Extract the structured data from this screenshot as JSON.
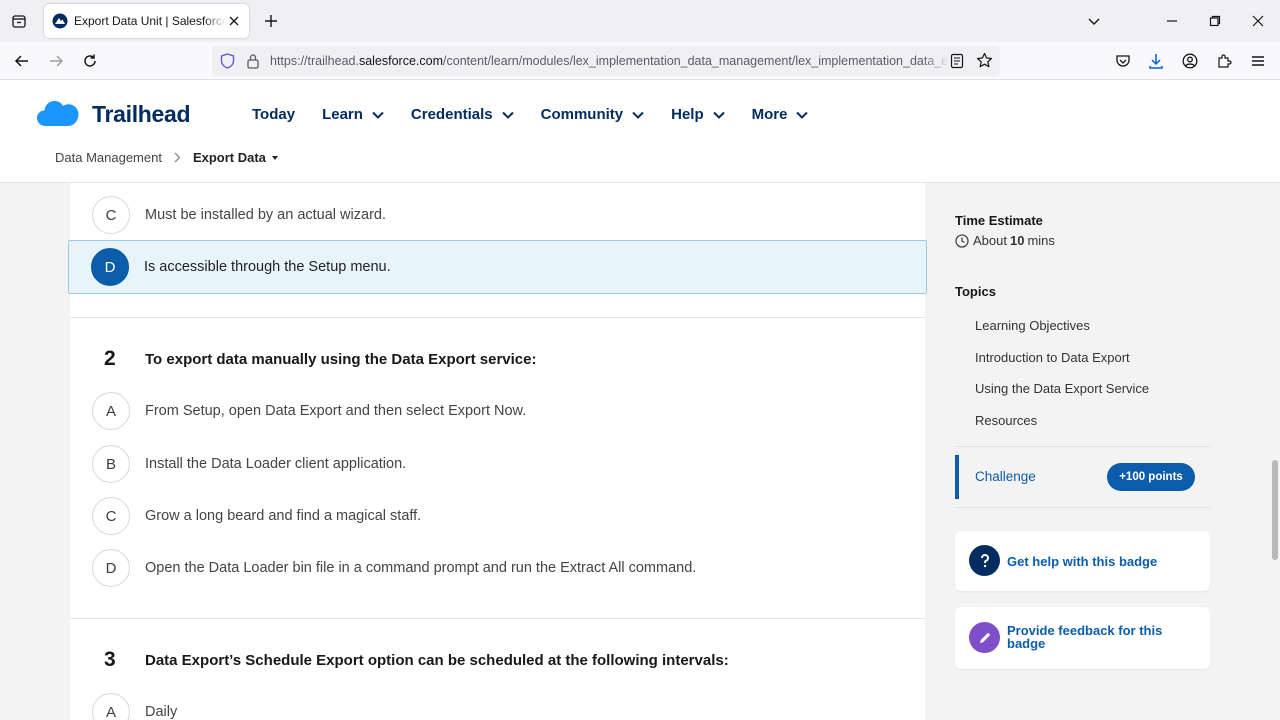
{
  "browser": {
    "tab_title": "Export Data Unit | Salesforce Trailhead",
    "url_prefix": "https://trailhead.",
    "url_domain": "salesforce.com",
    "url_path": "/content/learn/modules/lex_implementation_data_management/lex_implementation_data_export"
  },
  "site": {
    "logo_text": "Trailhead",
    "nav": [
      {
        "label": "Today"
      },
      {
        "label": "Learn"
      },
      {
        "label": "Credentials"
      },
      {
        "label": "Community"
      },
      {
        "label": "Help"
      },
      {
        "label": "More"
      }
    ],
    "breadcrumb": {
      "parent": "Data Management",
      "current": "Export Data"
    }
  },
  "quiz": {
    "q1_answers": [
      {
        "letter": "C",
        "text": "Must be installed by an actual wizard.",
        "selected": false
      },
      {
        "letter": "D",
        "text": "Is accessible through the Setup menu.",
        "selected": true
      }
    ],
    "q2": {
      "number": "2",
      "text": "To export data manually using the Data Export service:",
      "answers": [
        {
          "letter": "A",
          "text": "From Setup, open Data Export and then select Export Now."
        },
        {
          "letter": "B",
          "text": "Install the Data Loader client application."
        },
        {
          "letter": "C",
          "text": "Grow a long beard and find a magical staff."
        },
        {
          "letter": "D",
          "text": "Open the Data Loader bin file in a command prompt and run the Extract All command."
        }
      ]
    },
    "q3": {
      "number": "3",
      "text": "Data Export’s Schedule Export option can be scheduled at the following intervals:",
      "answers": [
        {
          "letter": "A",
          "text": "Daily"
        }
      ]
    }
  },
  "sidebar": {
    "time_label": "Time Estimate",
    "time_prefix": "About ",
    "time_value": "10",
    "time_suffix": " mins",
    "topics_label": "Topics",
    "topics": [
      "Learning Objectives",
      "Introduction to Data Export",
      "Using the Data Export Service",
      "Resources"
    ],
    "challenge_label": "Challenge",
    "challenge_points": "+100 points",
    "help_label": "Get help with this badge",
    "feedback_label": "Provide feedback for this badge"
  },
  "colors": {
    "brand_blue": "#0b5cab",
    "navy": "#032d60",
    "help_icon": "#032d60",
    "feedback_icon": "#7f4fc9",
    "cloud": "#1b96ff"
  }
}
